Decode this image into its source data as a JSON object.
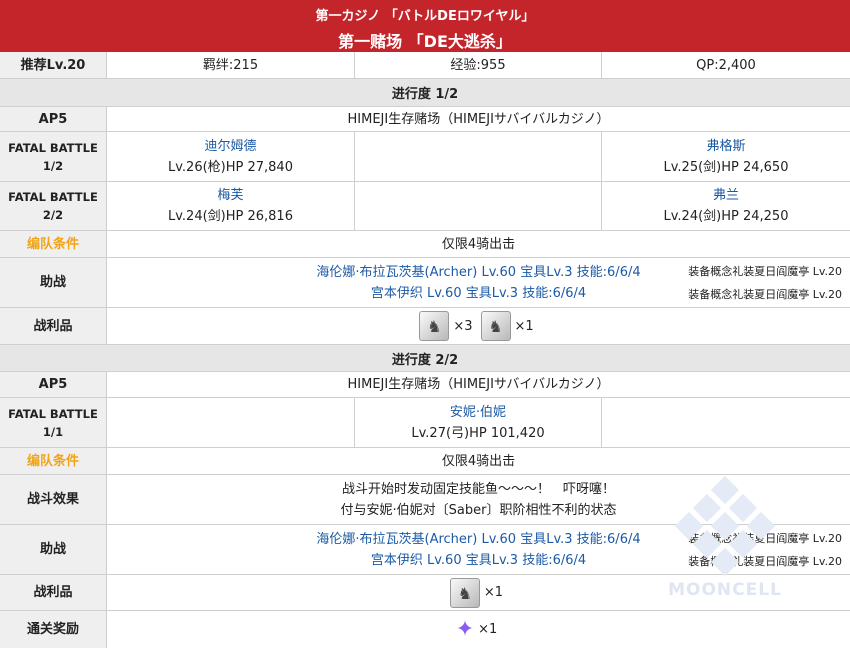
{
  "header": {
    "subtitle": "第一カジノ 「バトルDEロワイヤル」",
    "title": "第一赌场 「DE大逃杀」"
  },
  "info": {
    "recommended": "推荐Lv.20",
    "bond": "羁绊:215",
    "exp": "经验:955",
    "qp": "QP:2,400"
  },
  "progress1": {
    "title": "进行度 1/2",
    "ap": "AP5",
    "location": "HIMEJI生存赌场（HIMEJIサバイバルカジノ）",
    "battle1_label_a": "FATAL BATTLE",
    "battle1_label_b": "1/2",
    "b1_left_name": "迪尔姆德",
    "b1_left_stats": "Lv.26(枪)HP 27,840",
    "b1_right_name": "弗格斯",
    "b1_right_stats": "Lv.25(剑)HP 24,650",
    "battle2_label_a": "FATAL BATTLE",
    "battle2_label_b": "2/2",
    "b2_left_name": "梅芙",
    "b2_left_stats": "Lv.24(剑)HP 26,816",
    "b2_right_name": "弗兰",
    "b2_right_stats": "Lv.24(剑)HP 24,250",
    "cond_label": "编队条件",
    "cond": "仅限4骑出击",
    "support_label": "助战",
    "support1": "海伦娜·布拉瓦茨基(Archer) Lv.60 宝具Lv.3 技能:6/6/4",
    "support2": "宫本伊织 Lv.60 宝具Lv.3 技能:6/6/4",
    "ce1": "装备概念礼装夏日阎魔亭 Lv.20",
    "ce2": "装备概念礼装夏日阎魔亭 Lv.20",
    "drops_label": "战利品",
    "drop1_qty": "×3",
    "drop2_qty": "×1"
  },
  "progress2": {
    "title": "进行度 2/2",
    "ap": "AP5",
    "location": "HIMEJI生存赌场（HIMEJIサバイバルカジノ）",
    "battle_label_a": "FATAL BATTLE",
    "battle_label_b": "1/1",
    "boss_name": "安妮·伯妮",
    "boss_stats": "Lv.27(弓)HP 101,420",
    "cond_label": "编队条件",
    "cond": "仅限4骑出击",
    "effect_label": "战斗效果",
    "effect1": "战斗开始时发动固定技能鱼～～～！　吓呀噻！",
    "effect2": "付与安妮·伯妮对〔Saber〕职阶相性不利的状态",
    "support_label": "助战",
    "support1": "海伦娜·布拉瓦茨基(Archer) Lv.60 宝具Lv.3 技能:6/6/4",
    "support2": "宫本伊织 Lv.60 宝具Lv.3 技能:6/6/4",
    "ce1": "装备概念礼装夏日阎魔亭 Lv.20",
    "ce2": "装备概念礼装夏日阎魔亭 Lv.20",
    "drops_label": "战利品",
    "drop_qty": "×1",
    "reward_label": "通关奖励",
    "reward_qty": "×1"
  },
  "watermark": "MOONCELL",
  "colors": {
    "header_bg": "#c3252b",
    "orange_label": "#f2a416",
    "link": "#1c5aa6"
  }
}
